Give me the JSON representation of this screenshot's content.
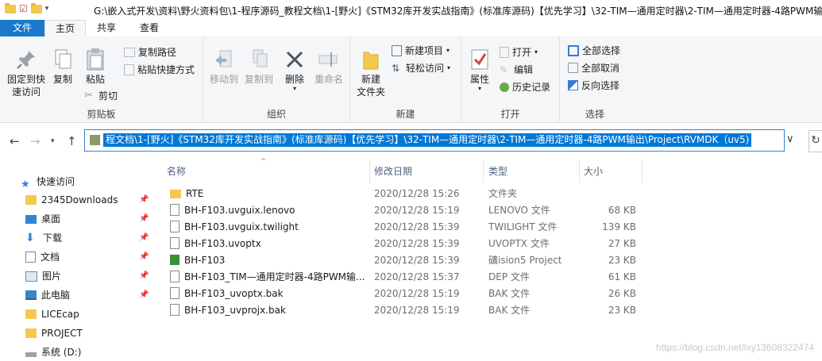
{
  "titlebar": {
    "path": "G:\\嵌入式开发\\资料\\野火资料包\\1-程序源码_教程文档\\1-[野火]《STM32库开发实战指南》(标准库源码)【优先学习】\\32-TIM—通用定时器\\2-TIM—通用定时器-4路PWM输出"
  },
  "tabs": {
    "file": "文件",
    "home": "主页",
    "share": "共享",
    "view": "查看"
  },
  "ribbon": {
    "clipboard": {
      "label": "剪贴板",
      "pin": "固定到快速访问",
      "copy": "复制",
      "paste": "粘贴",
      "copy_path": "复制路径",
      "paste_shortcut": "粘贴快捷方式",
      "cut": "剪切"
    },
    "organize": {
      "label": "组织",
      "move_to": "移动到",
      "copy_to": "复制到",
      "delete": "删除",
      "rename": "重命名"
    },
    "new": {
      "label": "新建",
      "new_folder": "新建\n文件夹",
      "new_item": "新建项目",
      "easy_access": "轻松访问"
    },
    "open": {
      "label": "打开",
      "properties": "属性",
      "open": "打开",
      "edit": "编辑",
      "history": "历史记录"
    },
    "select": {
      "label": "选择",
      "select_all": "全部选择",
      "select_none": "全部取消",
      "invert": "反向选择"
    }
  },
  "address": {
    "text": "程文档\\1-[野火]《STM32库开发实战指南》(标准库源码)【优先学习】\\32-TIM—通用定时器\\2-TIM—通用定时器-4路PWM输出\\Project\\RVMDK（uv5)"
  },
  "nav": {
    "quick_access": "快速访问",
    "items": [
      {
        "label": "2345Downloads",
        "pinned": true
      },
      {
        "label": "桌面",
        "pinned": true
      },
      {
        "label": "下载",
        "pinned": true
      },
      {
        "label": "文档",
        "pinned": true
      },
      {
        "label": "图片",
        "pinned": true
      },
      {
        "label": "此电脑",
        "pinned": true
      },
      {
        "label": "LICEcap",
        "pinned": false
      },
      {
        "label": "PROJECT",
        "pinned": false
      },
      {
        "label": "系统 (D:)",
        "pinned": false
      }
    ]
  },
  "columns": {
    "name": "名称",
    "date": "修改日期",
    "type": "类型",
    "size": "大小"
  },
  "files": [
    {
      "name": "RTE",
      "date": "2020/12/28 15:26",
      "type": "文件夹",
      "size": "",
      "icon": "folder-icon"
    },
    {
      "name": "BH-F103.uvguix.lenovo",
      "date": "2020/12/28 15:19",
      "type": "LENOVO 文件",
      "size": "68 KB",
      "icon": "file-icon"
    },
    {
      "name": "BH-F103.uvguix.twilight",
      "date": "2020/12/28 15:39",
      "type": "TWILIGHT 文件",
      "size": "139 KB",
      "icon": "file-icon"
    },
    {
      "name": "BH-F103.uvoptx",
      "date": "2020/12/28 15:39",
      "type": "UVOPTX 文件",
      "size": "27 KB",
      "icon": "file-icon"
    },
    {
      "name": "BH-F103",
      "date": "2020/12/28 15:39",
      "type": "礦ision5 Project",
      "size": "23 KB",
      "icon": "uvision-icon"
    },
    {
      "name": "BH-F103_TIM—通用定时器-4路PWM输...",
      "date": "2020/12/28 15:37",
      "type": "DEP 文件",
      "size": "61 KB",
      "icon": "file-icon"
    },
    {
      "name": "BH-F103_uvoptx.bak",
      "date": "2020/12/28 15:19",
      "type": "BAK 文件",
      "size": "26 KB",
      "icon": "file-icon"
    },
    {
      "name": "BH-F103_uvprojx.bak",
      "date": "2020/12/28 15:19",
      "type": "BAK 文件",
      "size": "23 KB",
      "icon": "file-icon"
    }
  ],
  "watermark": "https://blog.csdn.net/lxy13608322474",
  "colors": {
    "accent": "#1979ca",
    "selection": "#0078d7"
  }
}
